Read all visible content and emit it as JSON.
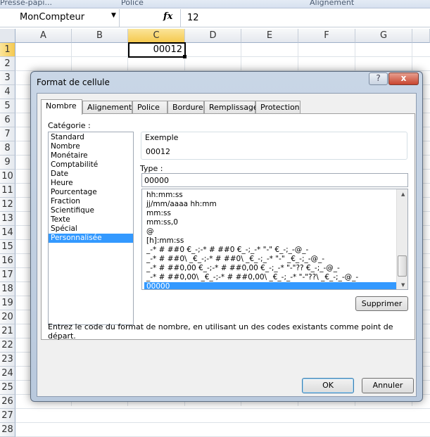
{
  "ribbon": {
    "groups": [
      "Presse-papi...",
      "Police",
      "Alignement"
    ]
  },
  "formula_bar": {
    "name_box": "MonCompteur",
    "fx": "fx",
    "value": "12"
  },
  "sheet": {
    "columns": [
      "A",
      "B",
      "C",
      "D",
      "E",
      "F",
      "G"
    ],
    "rows": [
      "1",
      "2",
      "3",
      "4",
      "5",
      "6",
      "7",
      "8",
      "9",
      "10",
      "11",
      "12",
      "13",
      "14",
      "15",
      "16",
      "17",
      "18",
      "19",
      "20",
      "21",
      "22",
      "23",
      "24",
      "25",
      "26",
      "27",
      "28"
    ],
    "active_cell": "C1",
    "cell_c1": "00012"
  },
  "dialog": {
    "title": "Format de cellule",
    "help": "?",
    "close": "x",
    "tabs": [
      "Nombre",
      "Alignement",
      "Police",
      "Bordure",
      "Remplissage",
      "Protection"
    ],
    "category_label": "Catégorie :",
    "categories": [
      "Standard",
      "Nombre",
      "Monétaire",
      "Comptabilité",
      "Date",
      "Heure",
      "Pourcentage",
      "Fraction",
      "Scientifique",
      "Texte",
      "Spécial",
      "Personnalisée"
    ],
    "selected_category": "Personnalisée",
    "example_label": "Exemple",
    "example_value": "00012",
    "type_label": "Type :",
    "type_value": "00000",
    "formats": [
      "hh:mm:ss",
      "jj/mm/aaaa hh:mm",
      "mm:ss",
      "mm:ss,0",
      "@",
      "[h]:mm:ss",
      "_-* # ##0 €_-;-* # ##0 €_-;_-* \"-\" €_-;_-@_-",
      "_-* # ##0\\ _€_-;-* # ##0\\ _€_-;_-* \"-\" _€_-;_-@_-",
      "_-* # ##0,00 €_-;-* # ##0,00 €_-;_-* \"-\"?? €_-;_-@_-",
      "_-* # ##0,00\\ _€_-;-* # ##0,00\\ _€_-;_-* \"-\"??\\ _€_-;_-@_-",
      "00000"
    ],
    "selected_format": "00000",
    "delete_button": "Supprimer",
    "hint": "Entrez le code du format de nombre, en utilisant un des codes existants comme point de départ.",
    "ok": "OK",
    "cancel": "Annuler"
  }
}
